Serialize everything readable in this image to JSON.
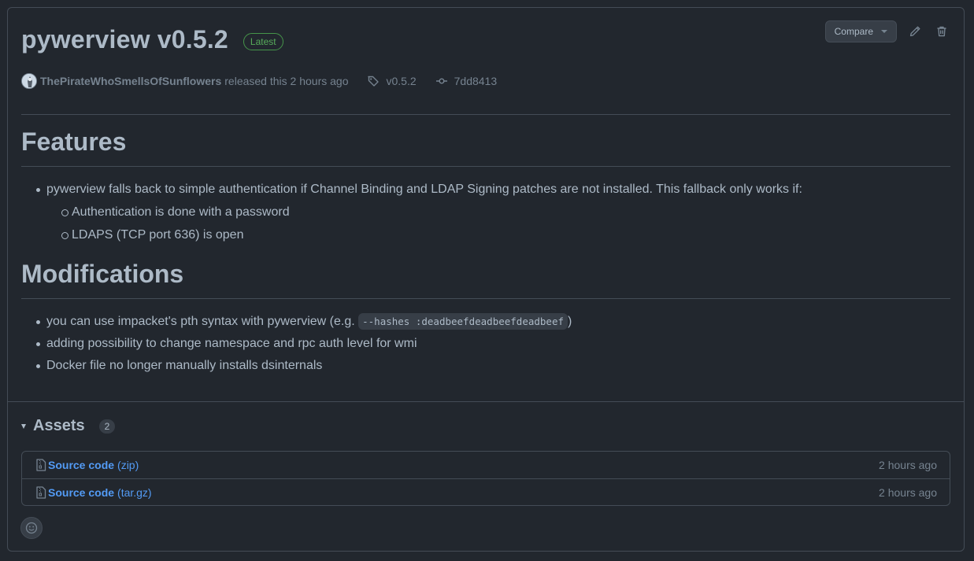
{
  "release": {
    "title": "pywerview v0.5.2",
    "badge": "Latest",
    "author": "ThePirateWhoSmellsOfSunflowers",
    "released_text": "released this 2 hours ago",
    "tag": "v0.5.2",
    "commit": "7dd8413"
  },
  "actions": {
    "compare_label": "Compare"
  },
  "sections": {
    "features_heading": "Features",
    "features": {
      "item1": "pywerview falls back to simple authentication if Channel Binding and LDAP Signing patches are not installed. This fallback only works if:",
      "sub1": "Authentication is done with a password",
      "sub2": "LDAPS (TCP port 636) is open"
    },
    "modifications_heading": "Modifications",
    "modifications": {
      "item1_prefix": "you can use impacket's pth syntax with pywerview (e.g. ",
      "item1_code": "--hashes :deadbeefdeadbeefdeadbeef",
      "item1_suffix": ")",
      "item2": "adding possibility to change namespace and rpc auth level for wmi",
      "item3": "Docker file no longer manually installs dsinternals"
    }
  },
  "assets": {
    "title": "Assets",
    "count": "2",
    "items": [
      {
        "name": "Source code",
        "ext": "(zip)",
        "time": "2 hours ago"
      },
      {
        "name": "Source code",
        "ext": "(tar.gz)",
        "time": "2 hours ago"
      }
    ]
  },
  "colors": {
    "background": "#22272e",
    "border": "#444c56",
    "link": "#539bf5",
    "latest_badge": "#57ab5a"
  }
}
